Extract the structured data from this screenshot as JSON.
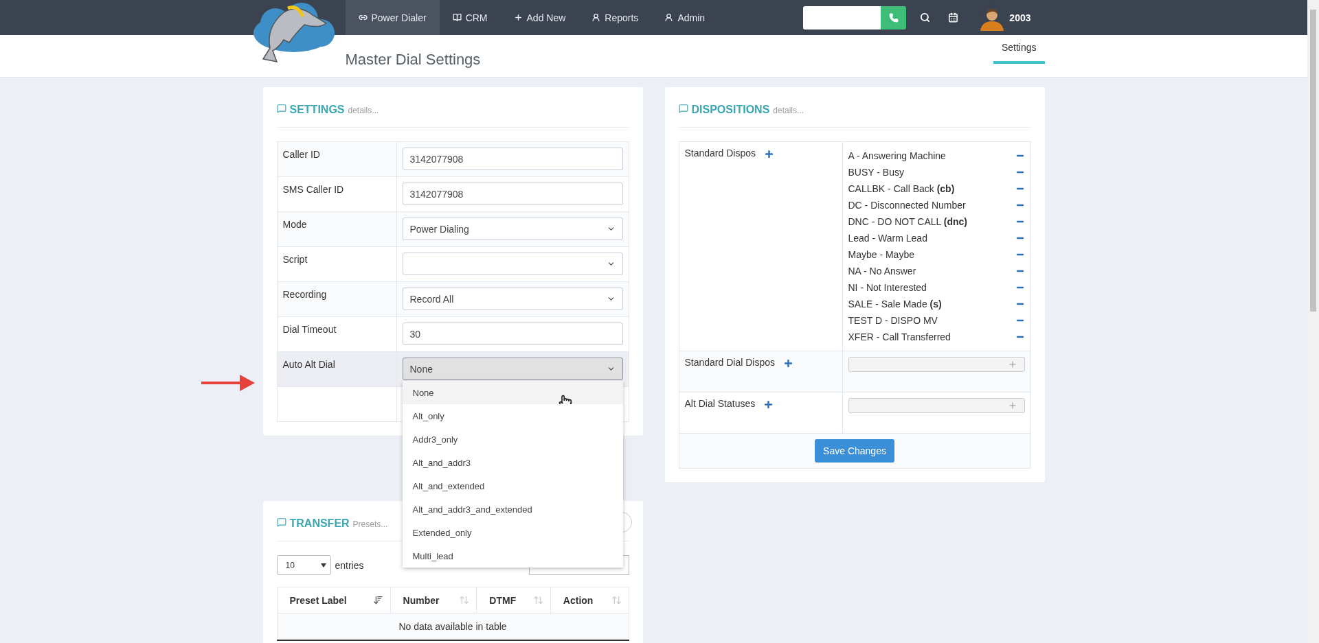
{
  "navbar": {
    "items": [
      {
        "label": "Power Dialer",
        "selected": true
      },
      {
        "label": "CRM",
        "selected": false
      },
      {
        "label": "Add New",
        "selected": false
      },
      {
        "label": "Reports",
        "selected": false
      },
      {
        "label": "Admin",
        "selected": false
      }
    ],
    "user": "2003"
  },
  "page": {
    "title": "Master Dial Settings",
    "tabs": [
      {
        "label": "Settings",
        "selected": true
      }
    ]
  },
  "settings": {
    "title": "SETTINGS",
    "subtitle": "details...",
    "rows": [
      {
        "label": "Caller ID",
        "kind": "input",
        "value": "3142077908",
        "focused": false
      },
      {
        "label": "SMS Caller ID",
        "kind": "input",
        "value": "3142077908",
        "focused": false
      },
      {
        "label": "Mode",
        "kind": "select",
        "value": "Power Dialing",
        "focused": false
      },
      {
        "label": "Script",
        "kind": "select",
        "focused": false
      },
      {
        "label": "Recording",
        "kind": "select",
        "value": "Record All",
        "focused": false
      },
      {
        "label": "Dial Timeout",
        "kind": "input",
        "value": "30",
        "focused": false
      },
      {
        "label": "Auto Alt Dial",
        "kind": "select",
        "value": "None",
        "focused": true,
        "options": [
          {
            "label": "None",
            "selected": true
          },
          {
            "label": "Alt_only",
            "selected": false
          },
          {
            "label": "Addr3_only",
            "selected": false
          },
          {
            "label": "Alt_and_addr3",
            "selected": false
          },
          {
            "label": "Alt_and_extended",
            "selected": false
          },
          {
            "label": "Alt_and_addr3_and_extended",
            "selected": false
          },
          {
            "label": "Extended_only",
            "selected": false
          },
          {
            "label": "Multi_lead",
            "selected": false
          }
        ]
      }
    ]
  },
  "dispositions": {
    "title": "DISPOSITIONS",
    "subtitle": "details...",
    "groups": [
      {
        "label": "Standard Dispos",
        "kind": "list",
        "items": [
          "A - Answering Machine",
          "BUSY - Busy",
          "CALLBK - Call Back **(cb)**",
          "DC - Disconnected Number",
          "DNC - DO NOT CALL **(dnc)**",
          "Lead - Warm Lead",
          "Maybe - Maybe",
          "NA - No Answer",
          "NI - Not Interested",
          "SALE - Sale Made **(s)**",
          "TEST D - DISPO MV",
          "XFER - Call Transferred"
        ]
      },
      {
        "label": "Standard Dial Dispos",
        "kind": "multiselect"
      },
      {
        "label": "Alt Dial Statuses",
        "kind": "multiselect"
      }
    ],
    "save_button": "Save Changes"
  },
  "transfer": {
    "title": "TRANSFER",
    "subtitle": "Presets...",
    "page_length": "10",
    "entries_label": "entries",
    "columns": [
      {
        "label": "Preset Label",
        "sorted": true
      },
      {
        "label": "Number",
        "sorted": false
      },
      {
        "label": "DTMF",
        "sorted": false
      },
      {
        "label": "Action",
        "sorted": false
      }
    ],
    "empty_message": "No data available in table"
  }
}
